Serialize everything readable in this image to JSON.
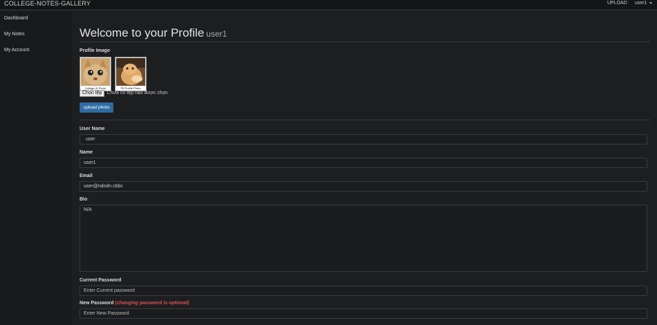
{
  "nav": {
    "brand": "COLLEGE-NOTES-GALLERY",
    "upload": "UPLOAD",
    "user": "user1"
  },
  "sidebar": {
    "items": [
      {
        "label": "Dashboard"
      },
      {
        "label": "My Notes"
      },
      {
        "label": "My Account"
      }
    ]
  },
  "profile": {
    "title": "Welcome to your Profile",
    "username": "user1",
    "image_label": "Profile Image",
    "thumbs": [
      {
        "caption": "College ID Photo"
      },
      {
        "caption": "FB Profile Photo"
      }
    ],
    "file_button": "Chọn tệp",
    "file_status": "Chưa có tệp nào được chọn",
    "upload_button": "upload photo"
  },
  "form": {
    "username_label": "User Name",
    "username_value": "user",
    "name_label": "Name",
    "name_value": "user1",
    "email_label": "Email",
    "email_value": "user@ndndn.cbbc",
    "bio_label": "Bio",
    "bio_value": "N/A",
    "current_password_label": "Current Password",
    "current_password_placeholder": "Enter Current password",
    "new_password_label": "New Password",
    "new_password_hint": "(changing password is optional)",
    "new_password_placeholder": "Enter New Password"
  },
  "colors": {
    "background": "#1d1e20",
    "sidebar": "#191a1c",
    "primary_button": "#2f6da3",
    "hint_red": "#d9534f"
  }
}
